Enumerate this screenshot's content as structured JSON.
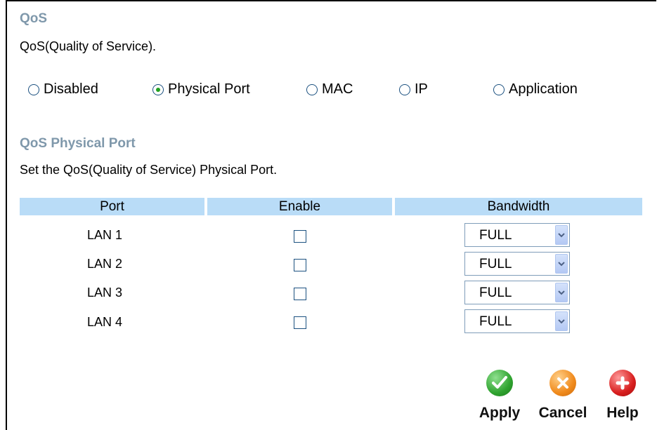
{
  "qos": {
    "title": "QoS",
    "description": "QoS(Quality of Service).",
    "mode_options": [
      {
        "label": "Disabled",
        "selected": false
      },
      {
        "label": "Physical Port",
        "selected": true
      },
      {
        "label": "MAC",
        "selected": false
      },
      {
        "label": "IP",
        "selected": false
      },
      {
        "label": "Application",
        "selected": false
      }
    ]
  },
  "physical_port": {
    "title": "QoS Physical Port",
    "description": "Set the QoS(Quality of Service) Physical Port.",
    "columns": [
      "Port",
      "Enable",
      "Bandwidth"
    ],
    "rows": [
      {
        "port": "LAN 1",
        "enabled": false,
        "bandwidth": "FULL"
      },
      {
        "port": "LAN 2",
        "enabled": false,
        "bandwidth": "FULL"
      },
      {
        "port": "LAN 3",
        "enabled": false,
        "bandwidth": "FULL"
      },
      {
        "port": "LAN 4",
        "enabled": false,
        "bandwidth": "FULL"
      }
    ]
  },
  "actions": {
    "apply": {
      "label": "Apply",
      "icon": "check-icon",
      "color": "#2fa32f"
    },
    "cancel": {
      "label": "Cancel",
      "icon": "x-icon",
      "color": "#f08a1c"
    },
    "help": {
      "label": "Help",
      "icon": "plus-icon",
      "color": "#d81e1e"
    }
  }
}
